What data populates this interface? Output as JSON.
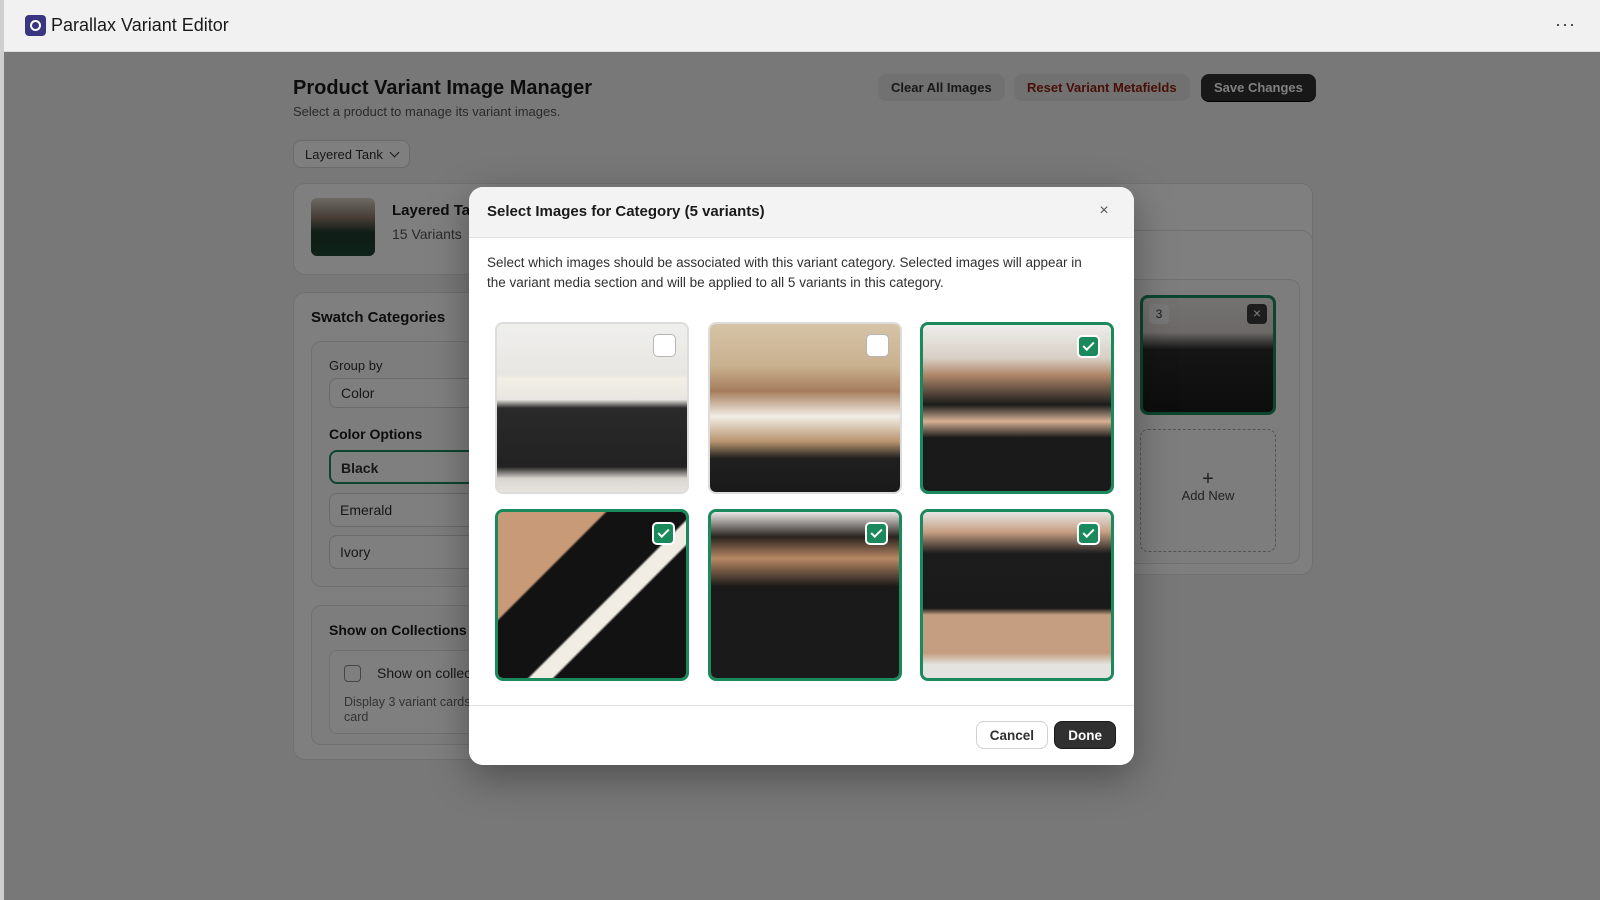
{
  "app": {
    "title": "Parallax Variant Editor",
    "more_label": "···"
  },
  "header": {
    "title": "Product Variant Image Manager",
    "subtitle": "Select a product to manage its variant images.",
    "clear_label": "Clear All Images",
    "reset_label": "Reset Variant Metafields",
    "save_label": "Save Changes"
  },
  "product_select": {
    "value": "Layered Tank"
  },
  "product": {
    "name": "Layered Tank",
    "variants": "15 Variants"
  },
  "swatch": {
    "title": "Swatch Categories",
    "groupby_label": "Group by",
    "groupby_value": "Color",
    "color_options_label": "Color Options",
    "options": [
      {
        "label": "Black",
        "active": true
      },
      {
        "label": "Emerald",
        "active": false
      },
      {
        "label": "Ivory",
        "active": false
      }
    ]
  },
  "collections": {
    "title": "Show on Collections",
    "checkbox_label": "Show on collections",
    "help": "Display 3 variant cards per product card"
  },
  "media": {
    "tile_number": "3",
    "remove_icon": "×",
    "add_icon": "+",
    "add_label": "Add New"
  },
  "modal": {
    "title": "Select Images for Category (5 variants)",
    "close_icon": "×",
    "description": "Select which images should be associated with this variant category. Selected images will appear in the variant media section and will be applied to all 5 variants in this category.",
    "images": [
      {
        "name": "full-length-side",
        "selected": false
      },
      {
        "name": "torso-smile",
        "selected": false
      },
      {
        "name": "front-shorts",
        "selected": true
      },
      {
        "name": "back-strap-closeup",
        "selected": true
      },
      {
        "name": "back-view",
        "selected": true
      },
      {
        "name": "full-front-shorts",
        "selected": true
      }
    ],
    "cancel_label": "Cancel",
    "done_label": "Done"
  },
  "colors": {
    "accent": "#1a8a5c",
    "primary_button": "#303030",
    "danger_text": "#8e1f0b",
    "logo": "#3a3580"
  }
}
